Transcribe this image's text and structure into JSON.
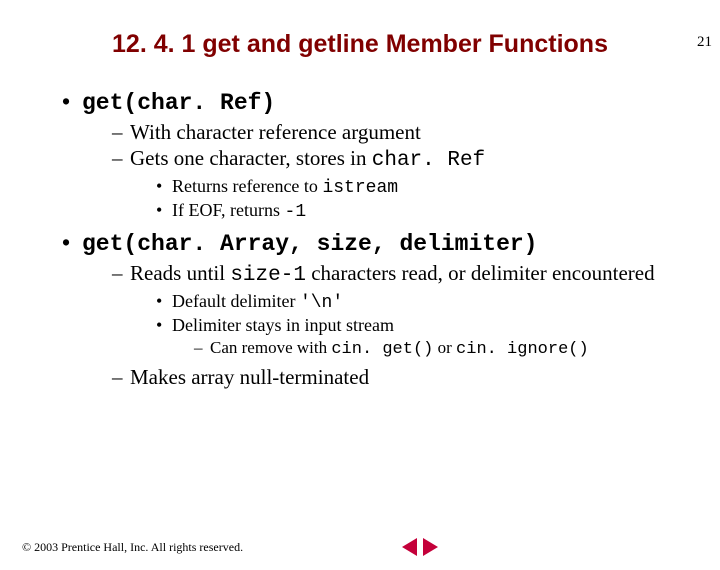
{
  "page_number": "21",
  "title": "12. 4. 1 get and getline Member Functions",
  "bullets": {
    "b1": "get(char. Ref)",
    "b1_1_a": "With character reference argument",
    "b1_2_a": "Gets one character, stores in ",
    "b1_2_code": "char. Ref",
    "b1_2_1_a": "Returns reference to ",
    "b1_2_1_code": "istream",
    "b1_2_2_a": "If EOF, returns ",
    "b1_2_2_code": "-1",
    "b2": "get(char. Array, size, delimiter)",
    "b2_1_a": "Reads until ",
    "b2_1_code": "size-1",
    "b2_1_b": " characters read, or delimiter encountered",
    "b2_1_1_a": "Default delimiter ",
    "b2_1_1_code": "'\\n'",
    "b2_1_2_a": "Delimiter stays in input stream",
    "b2_1_2_1_a": "Can remove with ",
    "b2_1_2_1_code1": "cin. get()",
    "b2_1_2_1_b": " or ",
    "b2_1_2_1_code2": "cin. ignore()",
    "b2_2_a": "Makes array null-terminated"
  },
  "footer": {
    "copyright": "© 2003 Prentice Hall, Inc. All rights reserved."
  }
}
